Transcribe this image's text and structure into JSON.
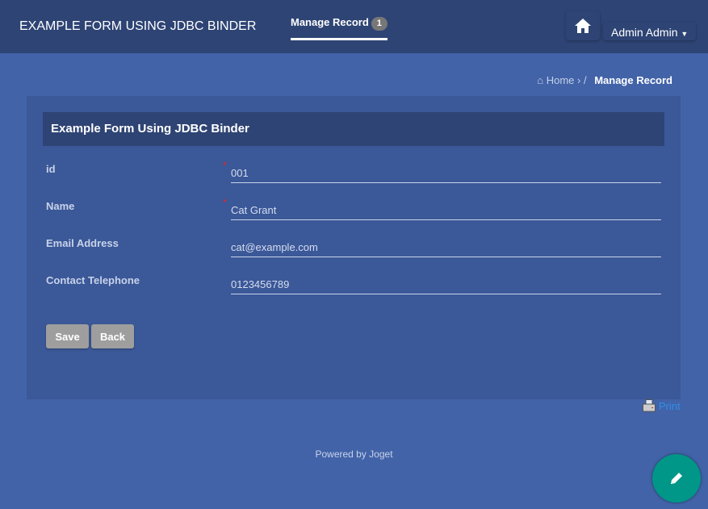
{
  "header": {
    "brand": "EXAMPLE FORM USING JDBC BINDER",
    "nav_item": "Manage Record",
    "nav_badge": "1",
    "user": "Admin Admin"
  },
  "breadcrumb": {
    "home": "Home",
    "current": "Manage Record"
  },
  "form": {
    "title": "Example Form Using JDBC Binder",
    "fields": [
      {
        "label": "id",
        "value": "001",
        "required": true
      },
      {
        "label": "Name",
        "value": "Cat Grant",
        "required": true
      },
      {
        "label": "Email Address",
        "value": "cat@example.com",
        "required": false
      },
      {
        "label": "Contact Telephone",
        "value": "0123456789",
        "required": false
      }
    ],
    "save_label": "Save",
    "back_label": "Back"
  },
  "print_label": "Print",
  "footer": "Powered by Joget",
  "colors": {
    "header": "#2e4474",
    "background": "#4263a8",
    "panel": "#3b5898",
    "fab": "#009688",
    "required": "#ee2222"
  },
  "icons": {
    "home": "home-icon",
    "print": "printer-icon",
    "fab": "pencil-icon"
  }
}
